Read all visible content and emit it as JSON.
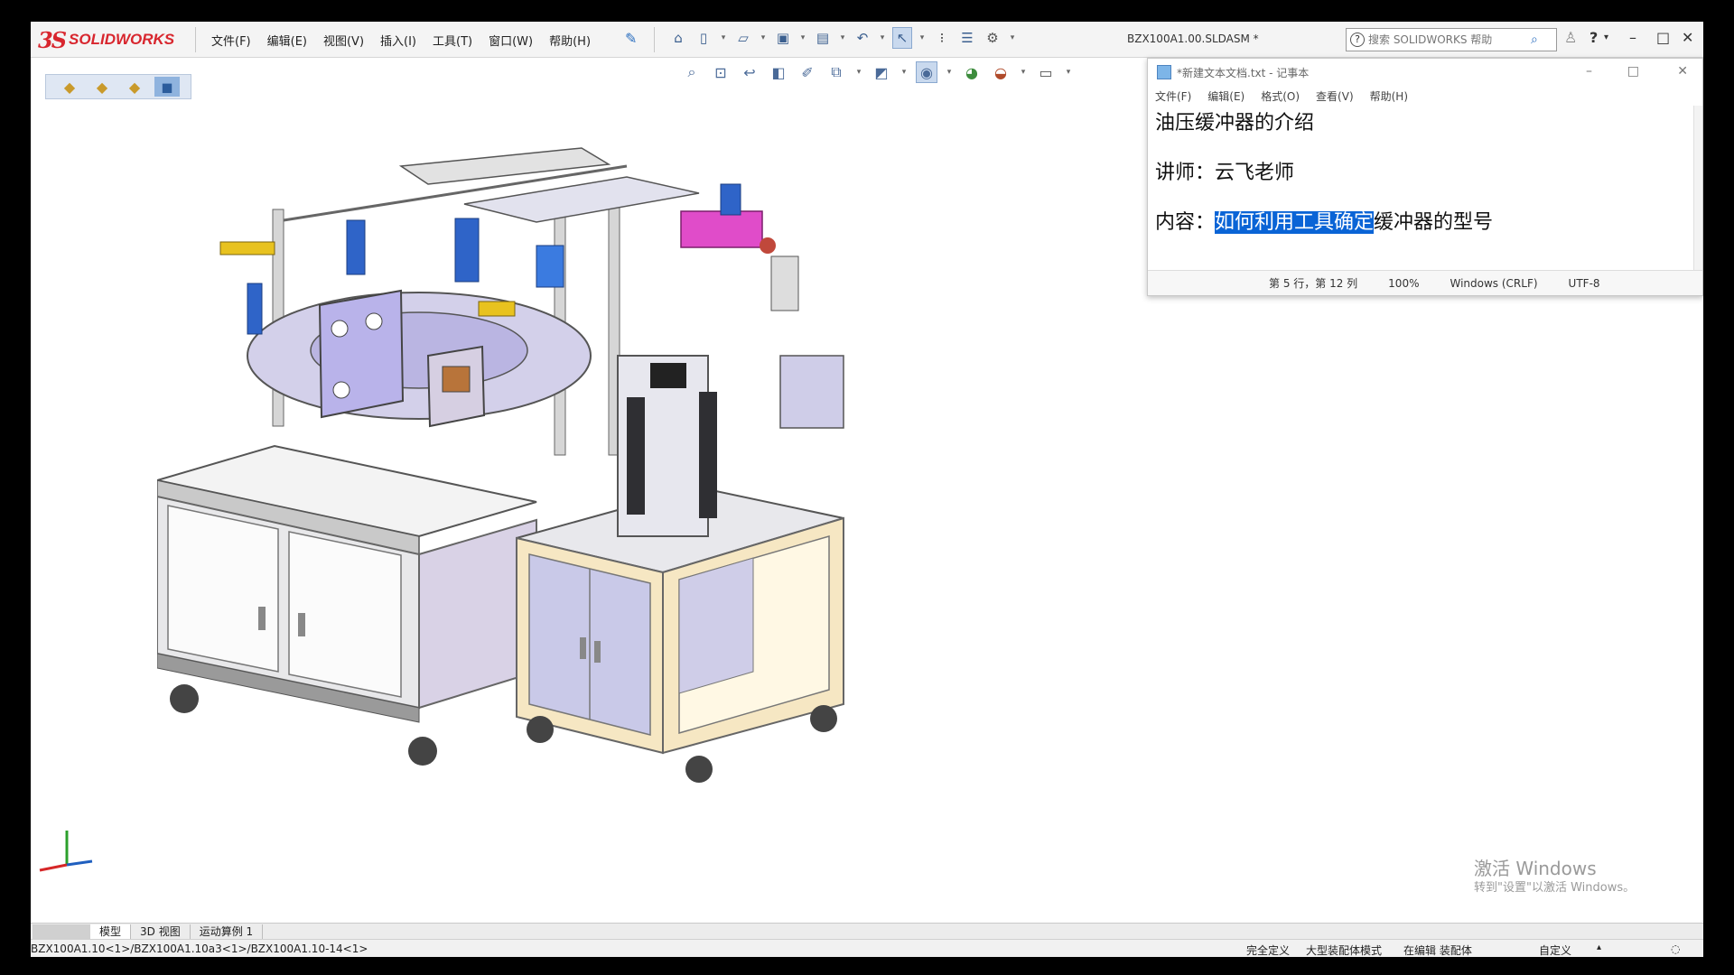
{
  "app": {
    "logo_mark": "3S",
    "logo_text": "SOLIDWORKS",
    "document_title": "BZX100A1.00.SLDASM *",
    "menus": [
      "文件(F)",
      "编辑(E)",
      "视图(V)",
      "插入(I)",
      "工具(T)",
      "窗口(W)",
      "帮助(H)"
    ],
    "search_placeholder": "搜索 SOLIDWORKS 帮助"
  },
  "notepad": {
    "title": "*新建文本文档.txt - 记事本",
    "menus": [
      "文件(F)",
      "编辑(E)",
      "格式(O)",
      "查看(V)",
      "帮助(H)"
    ],
    "line1": "油压缓冲器的介绍",
    "line2": "讲师：云飞老师",
    "line3_prefix": "内容：",
    "line3_selected": "如何利用工具确定",
    "line3_rest": "缓冲器的型号",
    "status": {
      "position": "第 5 行，第 12 列",
      "zoom": "100%",
      "line_ending": "Windows (CRLF)",
      "encoding": "UTF-8"
    }
  },
  "bottom_tabs": [
    "模型",
    "3D 视图",
    "运动算例 1"
  ],
  "status_bar": {
    "path": "BZX100A1.10<1>/BZX100A1.10a3<1>/BZX100A1.10-14<1>",
    "fully_defined": "完全定义",
    "large_assembly": "大型装配体模式",
    "editing": "在编辑 装配体",
    "custom": "自定义"
  },
  "watermark": {
    "line1": "激活 Windows",
    "line2": "转到\"设置\"以激活 Windows。"
  },
  "colors": {
    "logo_red": "#d8262e",
    "selection_blue": "#0a64d6",
    "machine_purple": "#b9b3ea",
    "frame_beige": "#f6e7c3"
  }
}
